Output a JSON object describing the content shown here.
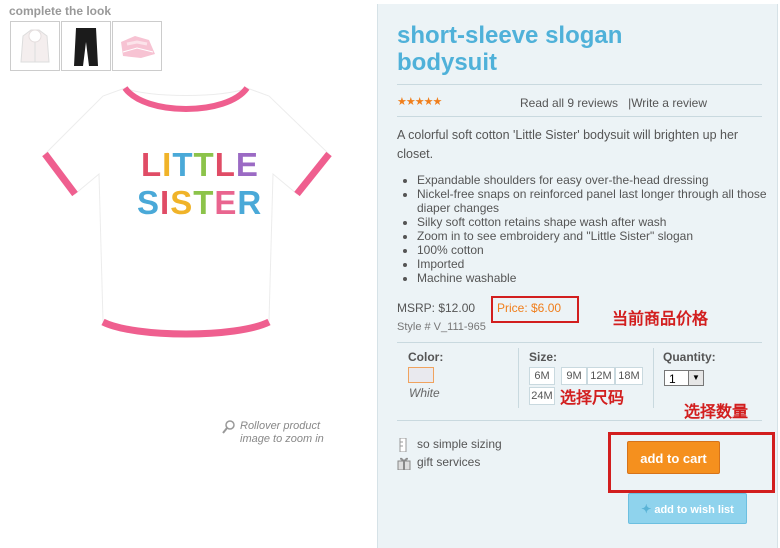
{
  "complete_the_look": {
    "title": "complete the look",
    "thumbnails": [
      "white-jacket",
      "black-pants",
      "pink-tutu-skirt"
    ]
  },
  "product": {
    "title": "short-sleeve slogan bodysuit",
    "image_text_line1": "LITTLE",
    "image_text_line2": "SISTER",
    "rating_stars": 5,
    "stars_text": "★★★★★",
    "reviews_label": "Read all 9 reviews",
    "write_review_label": "|Write a review",
    "description": "A colorful soft cotton 'Little Sister' bodysuit will brighten up her closet.",
    "features": [
      "Expandable shoulders for easy over-the-head dressing",
      "Nickel-free snaps on reinforced panel last longer through all those diaper changes",
      "Silky soft cotton retains shape wash after wash",
      "Zoom in to see embroidery and \"Little Sister\" slogan",
      "100% cotton",
      "Imported",
      "Machine washable"
    ],
    "msrp": "MSRP: $12.00",
    "price": "Price: $6.00",
    "style": "Style # V_111-965"
  },
  "rollover_hint": "Rollover product image to zoom in",
  "options": {
    "color_label": "Color:",
    "color_name": "White",
    "size_label": "Size:",
    "sizes": [
      "6M",
      "9M",
      "12M",
      "18M",
      "24M"
    ],
    "quantity_label": "Quantity:",
    "quantity_value": "1"
  },
  "services": {
    "sizing": "so simple sizing",
    "gift": "gift services"
  },
  "buttons": {
    "add_to_cart": "add to cart",
    "add_to_wish_list": "add to wish list"
  },
  "annotations": {
    "price": "当前商品价格",
    "size": "选择尺码",
    "quantity": "选择数量"
  },
  "colors": {
    "title": "#4fb1d9",
    "accent_orange": "#f5901e",
    "annotation_red": "#d21e1e",
    "panel_bg": "#ecf3f6"
  }
}
